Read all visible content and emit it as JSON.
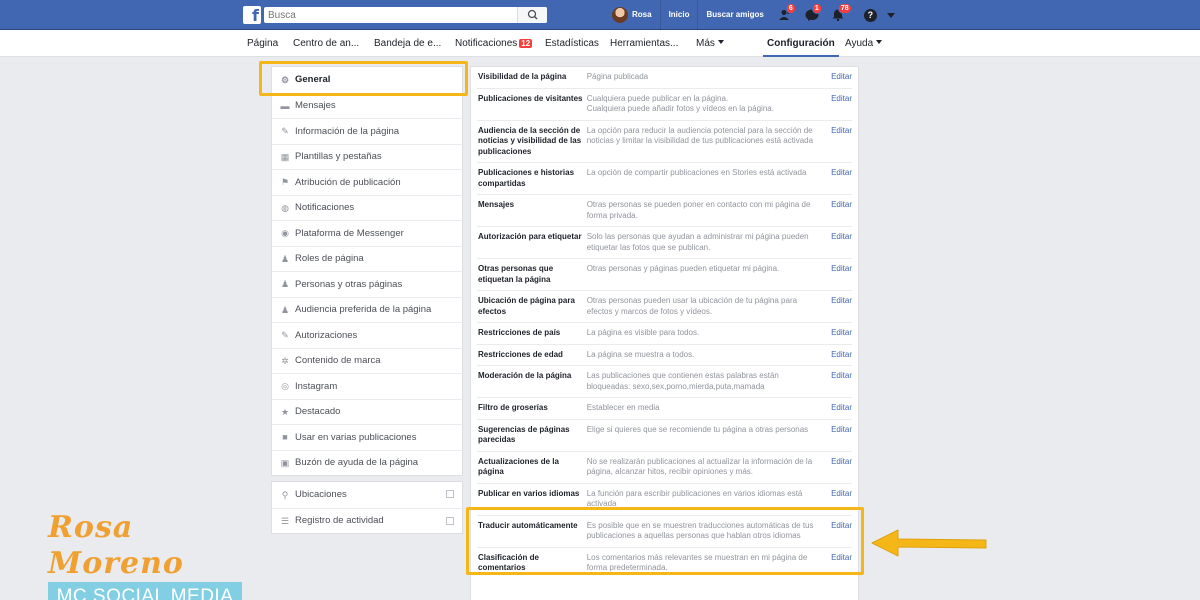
{
  "topbar": {
    "search_placeholder": "Busca",
    "user_name": "Rosa",
    "links": [
      "Inicio",
      "Buscar amigos"
    ],
    "badges": {
      "friends": "6",
      "messages": "1",
      "notifications": "78"
    },
    "help": "?"
  },
  "tabs": [
    {
      "label": "Página"
    },
    {
      "label": "Centro de an..."
    },
    {
      "label": "Bandeja de e..."
    },
    {
      "label": "Notificaciones",
      "badge": "12"
    },
    {
      "label": "Estadísticas"
    },
    {
      "label": "Herramientas..."
    },
    {
      "label": "Más"
    },
    {
      "label": "Configuración",
      "active": true
    },
    {
      "label": "Ayuda"
    }
  ],
  "menu": {
    "items": [
      {
        "label": "General",
        "icon": "⚙"
      },
      {
        "label": "Mensajes",
        "icon": "▬"
      },
      {
        "label": "Información de la página",
        "icon": "✎"
      },
      {
        "label": "Plantillas y pestañas",
        "icon": "▦"
      },
      {
        "label": "Atribución de publicación",
        "icon": "⚑"
      },
      {
        "label": "Notificaciones",
        "icon": "◍"
      },
      {
        "label": "Plataforma de Messenger",
        "icon": "◉"
      },
      {
        "label": "Roles de página",
        "icon": "♟"
      },
      {
        "label": "Personas y otras páginas",
        "icon": "♟"
      },
      {
        "label": "Audiencia preferida de la página",
        "icon": "♟"
      },
      {
        "label": "Autorizaciones",
        "icon": "✎"
      },
      {
        "label": "Contenido de marca",
        "icon": "✲"
      },
      {
        "label": "Instagram",
        "icon": "◎"
      },
      {
        "label": "Destacado",
        "icon": "★"
      },
      {
        "label": "Usar en varias publicaciones",
        "icon": "■"
      },
      {
        "label": "Buzón de ayuda de la página",
        "icon": "▣"
      }
    ],
    "secondary": [
      {
        "label": "Ubicaciones",
        "icon": "⚲"
      },
      {
        "label": "Registro de actividad",
        "icon": "☰"
      }
    ]
  },
  "settings": {
    "edit_label": "Editar",
    "rows": [
      {
        "label": "Visibilidad de la página",
        "desc": "Página publicada"
      },
      {
        "label": "Publicaciones de visitantes",
        "desc": "Cualquiera puede publicar en la página.\nCualquiera puede añadir fotos y vídeos en la página."
      },
      {
        "label": "Audiencia de la sección de noticias y visibilidad de las publicaciones",
        "desc": "La opción para reducir la audiencia potencial para la sección de noticias y limitar la visibilidad de tus publicaciones está activada"
      },
      {
        "label": "Publicaciones e historias compartidas",
        "desc": "La opción de compartir publicaciones en Stories está activada"
      },
      {
        "label": "Mensajes",
        "desc": "Otras personas se pueden poner en contacto con mi página de forma privada."
      },
      {
        "label": "Autorización para etiquetar",
        "desc": "Solo las personas que ayudan a administrar mi página pueden etiquetar las fotos que se publican."
      },
      {
        "label": "Otras personas que etiquetan la página",
        "desc": "Otras personas y páginas pueden etiquetar mi página."
      },
      {
        "label": "Ubicación de página para efectos",
        "desc": "Otras personas pueden usar la ubicación de tu página para efectos y marcos de fotos y vídeos."
      },
      {
        "label": "Restricciones de país",
        "desc": "La página es visible para todos."
      },
      {
        "label": "Restricciones de edad",
        "desc": "La página se muestra a todos."
      },
      {
        "label": "Moderación de la página",
        "desc": "Las publicaciones que contienen estas palabras están bloqueadas: sexo,sex,porno,mierda,puta,mamada"
      },
      {
        "label": "Filtro de groserías",
        "desc": "Establecer en media"
      },
      {
        "label": "Sugerencias de páginas parecidas",
        "desc": "Elige si quieres que se recomiende tu página a otras personas"
      },
      {
        "label": "Actualizaciones de la página",
        "desc": "No se realizarán publicaciones al actualizar la información de la página, alcanzar hitos, recibir opiniones y más."
      },
      {
        "label": "Publicar en varios idiomas",
        "desc": "La función para escribir publicaciones en varios idiomas está activada"
      },
      {
        "label": "Traducir automáticamente",
        "desc": "Es posible que en se muestren traducciones automáticas de tus publicaciones a aquellas personas que hablan otros idiomas"
      },
      {
        "label": "Clasificación de comentarios",
        "desc": "Los comentarios más relevantes se muestran en mi página de forma predeterminada."
      }
    ]
  },
  "brand": {
    "name": "Rosa Moreno",
    "subtitle": "MC SOCIAL MEDIA"
  },
  "colors": {
    "fb_blue": "#4267b2",
    "highlight": "#f5b718",
    "brand_orange": "#f0a030",
    "brand_cyan": "#82cfe4"
  }
}
